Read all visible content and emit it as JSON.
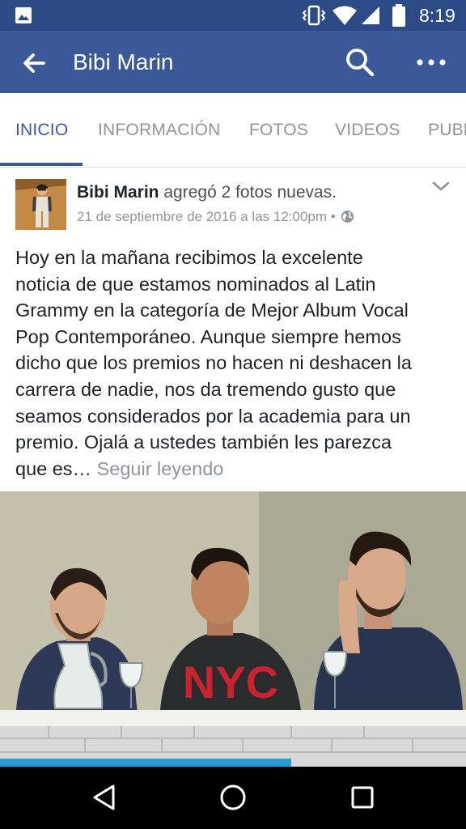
{
  "status_bar": {
    "time": "8:19",
    "icons": [
      "gallery-icon",
      "vibrate-icon",
      "wifi-icon",
      "signal-icon",
      "battery-icon"
    ]
  },
  "app_bar": {
    "title": "Bibi Marin",
    "icons": [
      "back-arrow-icon",
      "search-icon",
      "more-icon"
    ]
  },
  "tabs": [
    {
      "label": "INICIO",
      "active": true
    },
    {
      "label": "INFORMACIÓN",
      "active": false
    },
    {
      "label": "FOTOS",
      "active": false
    },
    {
      "label": "VIDEOS",
      "active": false
    },
    {
      "label": "PUBL",
      "active": false
    }
  ],
  "post": {
    "author": "Bibi Marin",
    "action": "agregó 2 fotos nuevas.",
    "timestamp": "21 de septiembre de 2016 a las 12:00pm",
    "separator": "•",
    "text_lines": [
      "Hoy en la mañana recibimos la excelente",
      "noticia de que estamos nominados al Latin",
      "Grammy en la categoría de Mejor Album Vocal",
      "Pop Contemporáneo. Aunque siempre hemos",
      "dicho que los premios no hacen ni deshacen la",
      "carrera de nadie, nos da tremendo gusto que",
      "seamos considerados por la academia para un",
      "premio. Ojalá a ustedes también les parezca"
    ],
    "last_line": "que es…",
    "see_more": "Seguir leyendo",
    "photo_shirt_text": "NYC"
  },
  "colors": {
    "status_bar": "#2b4a86",
    "app_bar": "#3b5998",
    "accent": "#3b5998",
    "muted_text": "#90949c",
    "body_text": "#1d2129"
  }
}
